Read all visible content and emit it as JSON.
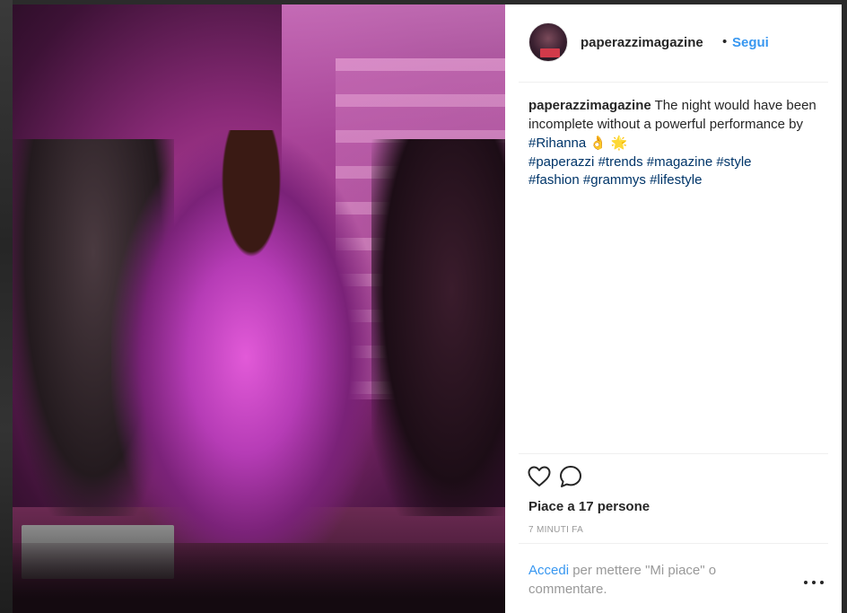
{
  "post": {
    "username": "paperazzimagazine",
    "dot": "•",
    "follow_label": "Segui",
    "caption": {
      "username": "paperazzimagazine",
      "text": "The night would have been incomplete without a powerful performance by",
      "mention": "#Rihanna",
      "emoji": "👌 🌟",
      "hashtags": [
        "#paperazzi",
        "#trends",
        "#magazine",
        "#style",
        "#fashion",
        "#grammys",
        "#lifestyle"
      ]
    },
    "likes": "Piace a 17 persone",
    "time": "7 MINUTI FA",
    "login_link": "Accedi",
    "login_rest": "per mettere \"Mi piace\" o commentare."
  },
  "icons": {
    "like": "heart-icon",
    "comment": "comment-icon",
    "more": "more-options-icon"
  },
  "colors": {
    "link": "#3897f0",
    "hashtag": "#003569",
    "text": "#262626",
    "muted": "#999999"
  }
}
